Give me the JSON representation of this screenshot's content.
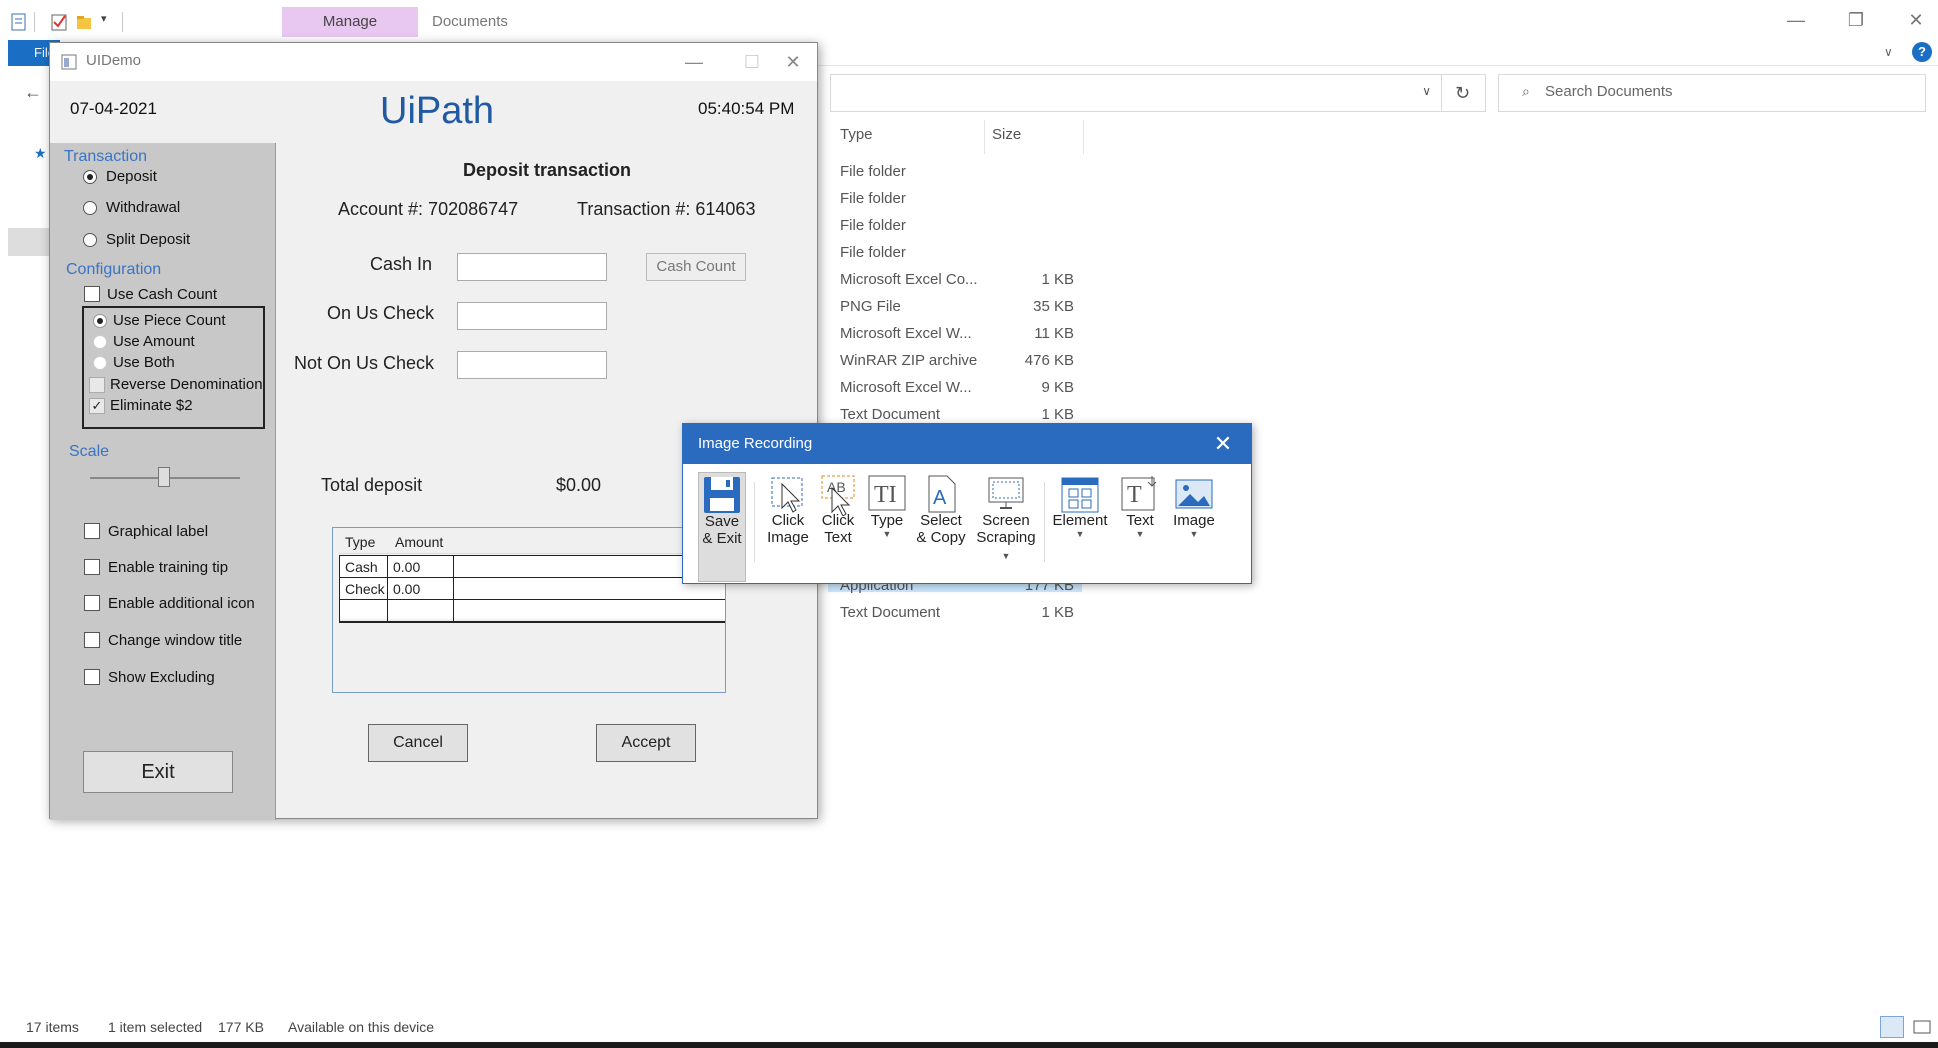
{
  "explorer": {
    "manage_tab": "Manage",
    "title": "Documents",
    "file_tab": "File",
    "search_placeholder": "Search Documents",
    "columns": {
      "type": "Type",
      "size": "Size"
    },
    "rows": [
      {
        "type": "File folder",
        "size": ""
      },
      {
        "type": "File folder",
        "size": ""
      },
      {
        "type": "File folder",
        "size": ""
      },
      {
        "type": "File folder",
        "size": ""
      },
      {
        "type": "Microsoft Excel Co...",
        "size": "1 KB"
      },
      {
        "type": "PNG File",
        "size": "35 KB"
      },
      {
        "type": "Microsoft Excel W...",
        "size": "11 KB"
      },
      {
        "type": "WinRAR ZIP archive",
        "size": "476 KB"
      },
      {
        "type": "Microsoft Excel W...",
        "size": "9 KB"
      },
      {
        "type": "Text Document",
        "size": "1 KB"
      },
      {
        "type": "Application",
        "size": "177 KB"
      },
      {
        "type": "Text Document",
        "size": "1 KB"
      }
    ],
    "status": {
      "items": "17 items",
      "selected": "1 item selected",
      "size": "177 KB",
      "availability": "Available on this device"
    }
  },
  "uidemo": {
    "window_title": "UIDemo",
    "date": "07-04-2021",
    "logo": "UiPath",
    "time": "05:40:54 PM",
    "transaction_label": "Transaction",
    "transaction_options": [
      "Deposit",
      "Withdrawal",
      "Split Deposit"
    ],
    "transaction_selected": "Deposit",
    "configuration_label": "Configuration",
    "use_cash_count": "Use Cash Count",
    "count_options": [
      "Use Piece Count",
      "Use Amount",
      "Use Both"
    ],
    "reverse_denomination": "Reverse Denomination",
    "eliminate_2": "Eliminate $2",
    "scale_label": "Scale",
    "checkboxes": [
      "Graphical label",
      "Enable training tip",
      "Enable additional icon",
      "Change window title",
      "Show Excluding"
    ],
    "exit": "Exit",
    "form_title": "Deposit transaction",
    "account": "Account #: 702086747",
    "transaction": "Transaction #: 614063",
    "fields": [
      "Cash In",
      "On Us Check",
      "Not On Us Check"
    ],
    "cash_count_button": "Cash Count",
    "total_label": "Total deposit",
    "total_value": "$0.00",
    "grid": {
      "headers": [
        "Type",
        "Amount"
      ],
      "rows": [
        [
          "Cash",
          "0.00"
        ],
        [
          "Check",
          "0.00"
        ]
      ]
    },
    "cancel": "Cancel",
    "accept": "Accept"
  },
  "image_recording": {
    "title": "Image Recording",
    "tools": [
      {
        "line1": "Save",
        "line2": "& Exit",
        "icon": "save-icon"
      },
      {
        "line1": "Click",
        "line2": "Image",
        "icon": "click-image-icon"
      },
      {
        "line1": "Click",
        "line2": "Text",
        "icon": "click-text-icon"
      },
      {
        "line1": "Type",
        "line2": "",
        "icon": "type-icon"
      },
      {
        "line1": "Select",
        "line2": "& Copy",
        "icon": "select-copy-icon"
      },
      {
        "line1": "Screen",
        "line2": "Scraping",
        "icon": "screen-scraping-icon"
      },
      {
        "line1": "Element",
        "line2": "",
        "icon": "element-icon"
      },
      {
        "line1": "Text",
        "line2": "",
        "icon": "text-icon"
      },
      {
        "line1": "Image",
        "line2": "",
        "icon": "image-icon"
      }
    ]
  }
}
